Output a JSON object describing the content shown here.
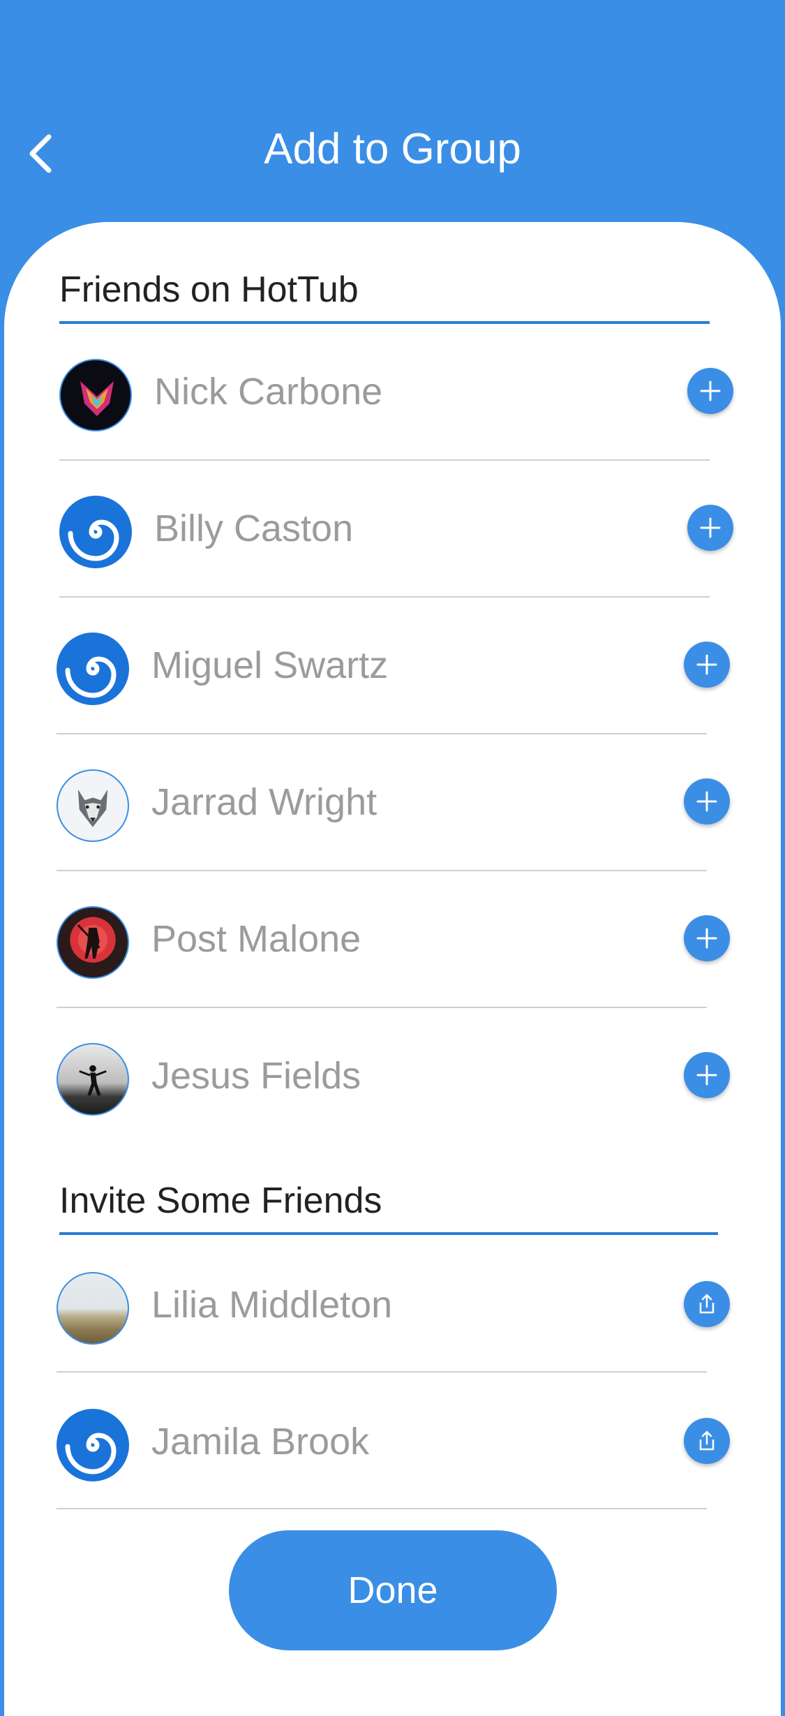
{
  "header": {
    "title": "Add to Group",
    "back_icon": "chevron-left-icon"
  },
  "friends_section": {
    "title": "Friends on HotTub",
    "items": [
      {
        "name": "Nick Carbone",
        "avatar": "wolf-neon-avatar",
        "action_icon": "plus-icon"
      },
      {
        "name": "Billy Caston",
        "avatar": "spiral-default-avatar",
        "action_icon": "plus-icon"
      },
      {
        "name": "Miguel Swartz",
        "avatar": "spiral-default-avatar",
        "action_icon": "plus-icon"
      },
      {
        "name": "Jarrad Wright",
        "avatar": "wolf-avatar",
        "action_icon": "plus-icon"
      },
      {
        "name": "Post Malone",
        "avatar": "red-moon-avatar",
        "action_icon": "plus-icon"
      },
      {
        "name": "Jesus Fields",
        "avatar": "figure-landscape-avatar",
        "action_icon": "plus-icon"
      }
    ]
  },
  "invite_section": {
    "title": "Invite Some Friends",
    "items": [
      {
        "name": "Lilia Middleton",
        "avatar": "beach-avatar",
        "action_icon": "share-icon"
      },
      {
        "name": "Jamila Brook",
        "avatar": "spiral-default-avatar",
        "action_icon": "share-icon"
      }
    ]
  },
  "done_button": {
    "label": "Done"
  },
  "colors": {
    "brand_blue": "#3a8ee6",
    "underline_blue": "#2a7bd6",
    "name_gray": "#9b9b9b"
  }
}
